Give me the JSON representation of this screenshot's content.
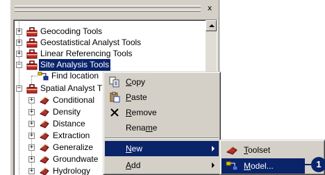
{
  "panel": {
    "close_glyph": "x"
  },
  "tree": {
    "items": [
      {
        "label": "Geocoding Tools",
        "expander": "+",
        "icon": "toolbox-icon"
      },
      {
        "label": "Geostatistical Analyst Tools",
        "expander": "+",
        "icon": "toolbox-icon"
      },
      {
        "label": "Linear Referencing Tools",
        "expander": "+",
        "icon": "toolbox-icon"
      },
      {
        "label": "Site Analysis Tools",
        "expander": "−",
        "icon": "toolbox-icon",
        "selected": true
      },
      {
        "label": "Find location",
        "icon": "model-icon"
      },
      {
        "label": "Spatial Analyst T",
        "expander": "−",
        "icon": "toolbox-icon"
      },
      {
        "label": "Conditional",
        "expander": "+",
        "icon": "toolset-icon"
      },
      {
        "label": "Density",
        "expander": "+",
        "icon": "toolset-icon"
      },
      {
        "label": "Distance",
        "expander": "+",
        "icon": "toolset-icon"
      },
      {
        "label": "Extraction",
        "expander": "+",
        "icon": "toolset-icon"
      },
      {
        "label": "Generalize",
        "expander": "+",
        "icon": "toolset-icon"
      },
      {
        "label": "Groundwate",
        "expander": "+",
        "icon": "toolset-icon"
      },
      {
        "label": "Hydrology",
        "expander": "+",
        "icon": "toolset-icon"
      }
    ]
  },
  "context_menu": {
    "copy": {
      "label": "Copy",
      "icon": "copy-icon"
    },
    "paste": {
      "label": "Paste",
      "icon": "paste-icon"
    },
    "remove": {
      "label": "Remove",
      "icon": "remove-icon"
    },
    "rename": {
      "label": "Rename"
    },
    "new": {
      "label": "New",
      "highlighted": true
    },
    "add": {
      "label": "Add"
    }
  },
  "submenu": {
    "toolset": {
      "label": "Toolset",
      "icon": "toolset-icon"
    },
    "model": {
      "label": "Model...",
      "icon": "model-icon",
      "highlighted": true
    }
  },
  "callout": {
    "number": "1"
  },
  "colors": {
    "selection": "#0a246a",
    "face": "#d4d0c8",
    "toolbox_red": "#c0282a",
    "model_blue": "#1f3ea8",
    "model_yellow": "#e8c000"
  }
}
